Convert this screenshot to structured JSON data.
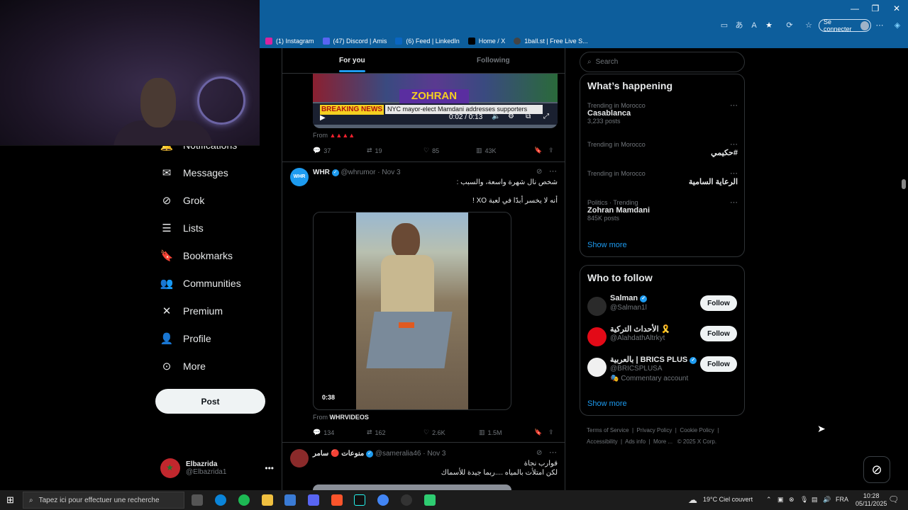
{
  "browser": {
    "bookmarks": [
      "(1) Instagram",
      "(47) Discord | Amis",
      "(6) Feed | LinkedIn",
      "Home / X",
      "1ball.st | Free Live S..."
    ],
    "signin_label": "Se connecter",
    "window_controls": [
      "minimize-icon",
      "restore-icon",
      "close-icon"
    ]
  },
  "nav": {
    "items": [
      "Notifications",
      "Messages",
      "Grok",
      "Lists",
      "Bookmarks",
      "Communities",
      "Premium",
      "Profile",
      "More"
    ],
    "post_label": "Post",
    "account": {
      "name": "Elbazrida",
      "handle": "@Elbazrida1"
    }
  },
  "tabs": {
    "for_you": "For you",
    "following": "Following"
  },
  "tweet1": {
    "video_banner_text": "ZOHRAN",
    "breaking_label": "BREAKING NEWS",
    "headline": "NYC mayor-elect Mamdani addresses supporters",
    "time": "0:02 / 0:13",
    "from_label": "From",
    "from_value": "▲▲▲▲",
    "replies": "37",
    "reposts": "19",
    "likes": "85",
    "views": "43K"
  },
  "tweet2": {
    "author": "WHR",
    "avatar_text": "WHR",
    "handle": "@whrumor",
    "date": "· Nov 3",
    "line1": "شخص نال شهرة واسعة، والسبب :",
    "line2": "أنه لا يخسر أبدًا في لعبة XO !",
    "duration": "0:38",
    "from_label": "From",
    "from_value": "WHRVIDEOS",
    "replies": "134",
    "reposts": "162",
    "likes": "2.6K",
    "views": "1.5M"
  },
  "tweet3": {
    "author": "منوعات 🔴 سامر",
    "handle": "@sameralia46",
    "date": "· Nov 3",
    "line1": "قوارب نجاة",
    "line2": "لكن امتلأت بالمياه ....ربما جيدة للأسماك"
  },
  "search": {
    "placeholder": "Search"
  },
  "whats_happening": {
    "title": "What’s happening",
    "trends": [
      {
        "context": "Trending in Morocco",
        "name": "Casablanca",
        "count": "3,233 posts"
      },
      {
        "context": "Trending in Morocco",
        "name": "#حكيمي",
        "count": ""
      },
      {
        "context": "Trending in Morocco",
        "name": "الرعاية السامية",
        "count": ""
      },
      {
        "context": "Politics · Trending",
        "name": "Zohran Mamdani",
        "count": "845K posts"
      }
    ],
    "show_more": "Show more"
  },
  "who_to_follow": {
    "title": "Who to follow",
    "accounts": [
      {
        "name": "Salman",
        "handle": "@Salman1l",
        "note": ""
      },
      {
        "name": "الأحداث التركية 🎗️",
        "handle": "@AlahdathAltrkyt",
        "note": ""
      },
      {
        "name": "بالعربية | BRICS PLUS",
        "handle": "@BRICSPLUSA",
        "note": "Commentary account"
      }
    ],
    "follow_label": "Follow",
    "show_more": "Show more"
  },
  "footer": {
    "links": [
      "Terms of Service",
      "Privacy Policy",
      "Cookie Policy",
      "Accessibility",
      "Ads info",
      "More ...",
      "© 2025 X Corp."
    ]
  },
  "taskbar": {
    "search_placeholder": "Tapez ici pour effectuer une recherche",
    "weather": "19°C  Ciel couvert",
    "language": "FRA",
    "time": "10:28",
    "date": "05/11/2025"
  },
  "colors": {
    "accent": "#1d9bf0",
    "background": "#000000",
    "chrome": "#0d5e9c"
  }
}
